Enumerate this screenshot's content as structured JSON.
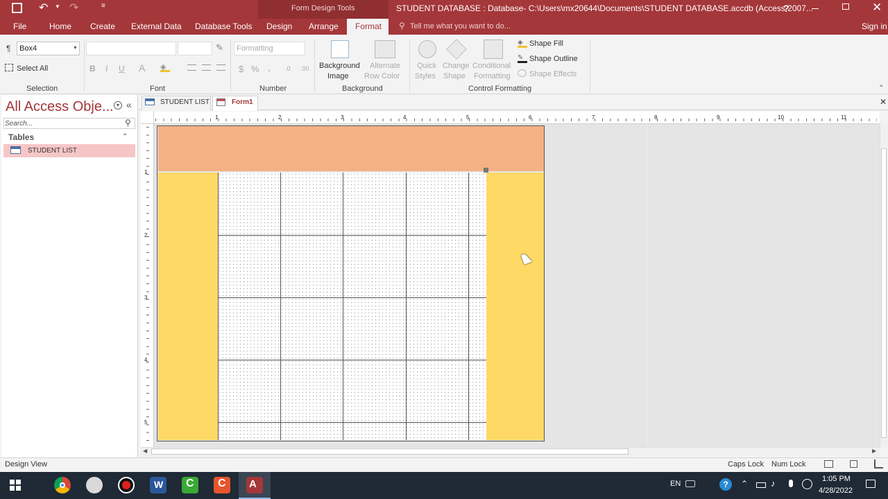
{
  "titlebar": {
    "context_tools": "Form Design Tools",
    "title": "STUDENT DATABASE : Database- C:\\Users\\mx20644\\Documents\\STUDENT DATABASE.accdb (Access 2007...",
    "help": "?",
    "signin": "Sign in"
  },
  "tabs": [
    "File",
    "Home",
    "Create",
    "External Data",
    "Database Tools",
    "Design",
    "Arrange",
    "Format"
  ],
  "active_tab": "Format",
  "tell_me": "Tell me what you want to do...",
  "ribbon": {
    "selection": {
      "object_value": "Box4",
      "select_all": "Select All",
      "label": "Selection"
    },
    "font": {
      "bold": "B",
      "italic": "I",
      "underline": "U",
      "font_color": "A",
      "label": "Font"
    },
    "number": {
      "format_placeholder": "Formatting",
      "currency": "$",
      "percent": "%",
      "comma": ",",
      "label": "Number"
    },
    "background": {
      "bg_image_1": "Background",
      "bg_image_2": "Image",
      "alt_row_1": "Alternate",
      "alt_row_2": "Row Color",
      "label": "Background"
    },
    "control_formatting": {
      "quick_1": "Quick",
      "quick_2": "Styles",
      "change_1": "Change",
      "change_2": "Shape",
      "cond_1": "Conditional",
      "cond_2": "Formatting",
      "shape_fill": "Shape Fill",
      "shape_outline": "Shape Outline",
      "shape_effects": "Shape Effects",
      "label": "Control Formatting"
    }
  },
  "nav": {
    "title": "All Access Obje...",
    "search_placeholder": "Search...",
    "section": "Tables",
    "items": [
      "STUDENT LIST"
    ]
  },
  "doc_tabs": [
    "STUDENT LIST",
    "Form1"
  ],
  "active_doc_tab": "Form1",
  "ruler_top": [
    "1",
    "2",
    "3",
    "4",
    "5",
    "6",
    "7",
    "8",
    "9",
    "10",
    "11"
  ],
  "ruler_left": [
    "1",
    "2",
    "3",
    "4",
    "5"
  ],
  "status": {
    "view": "Design View",
    "caps": "Caps Lock",
    "num": "Num Lock"
  },
  "taskbar": {
    "lang": "EN",
    "time": "1:05 PM",
    "date": "4/28/2022"
  },
  "colors": {
    "access_red": "#a4373a",
    "header_orange": "#f4b183",
    "side_yellow": "#ffd966"
  }
}
